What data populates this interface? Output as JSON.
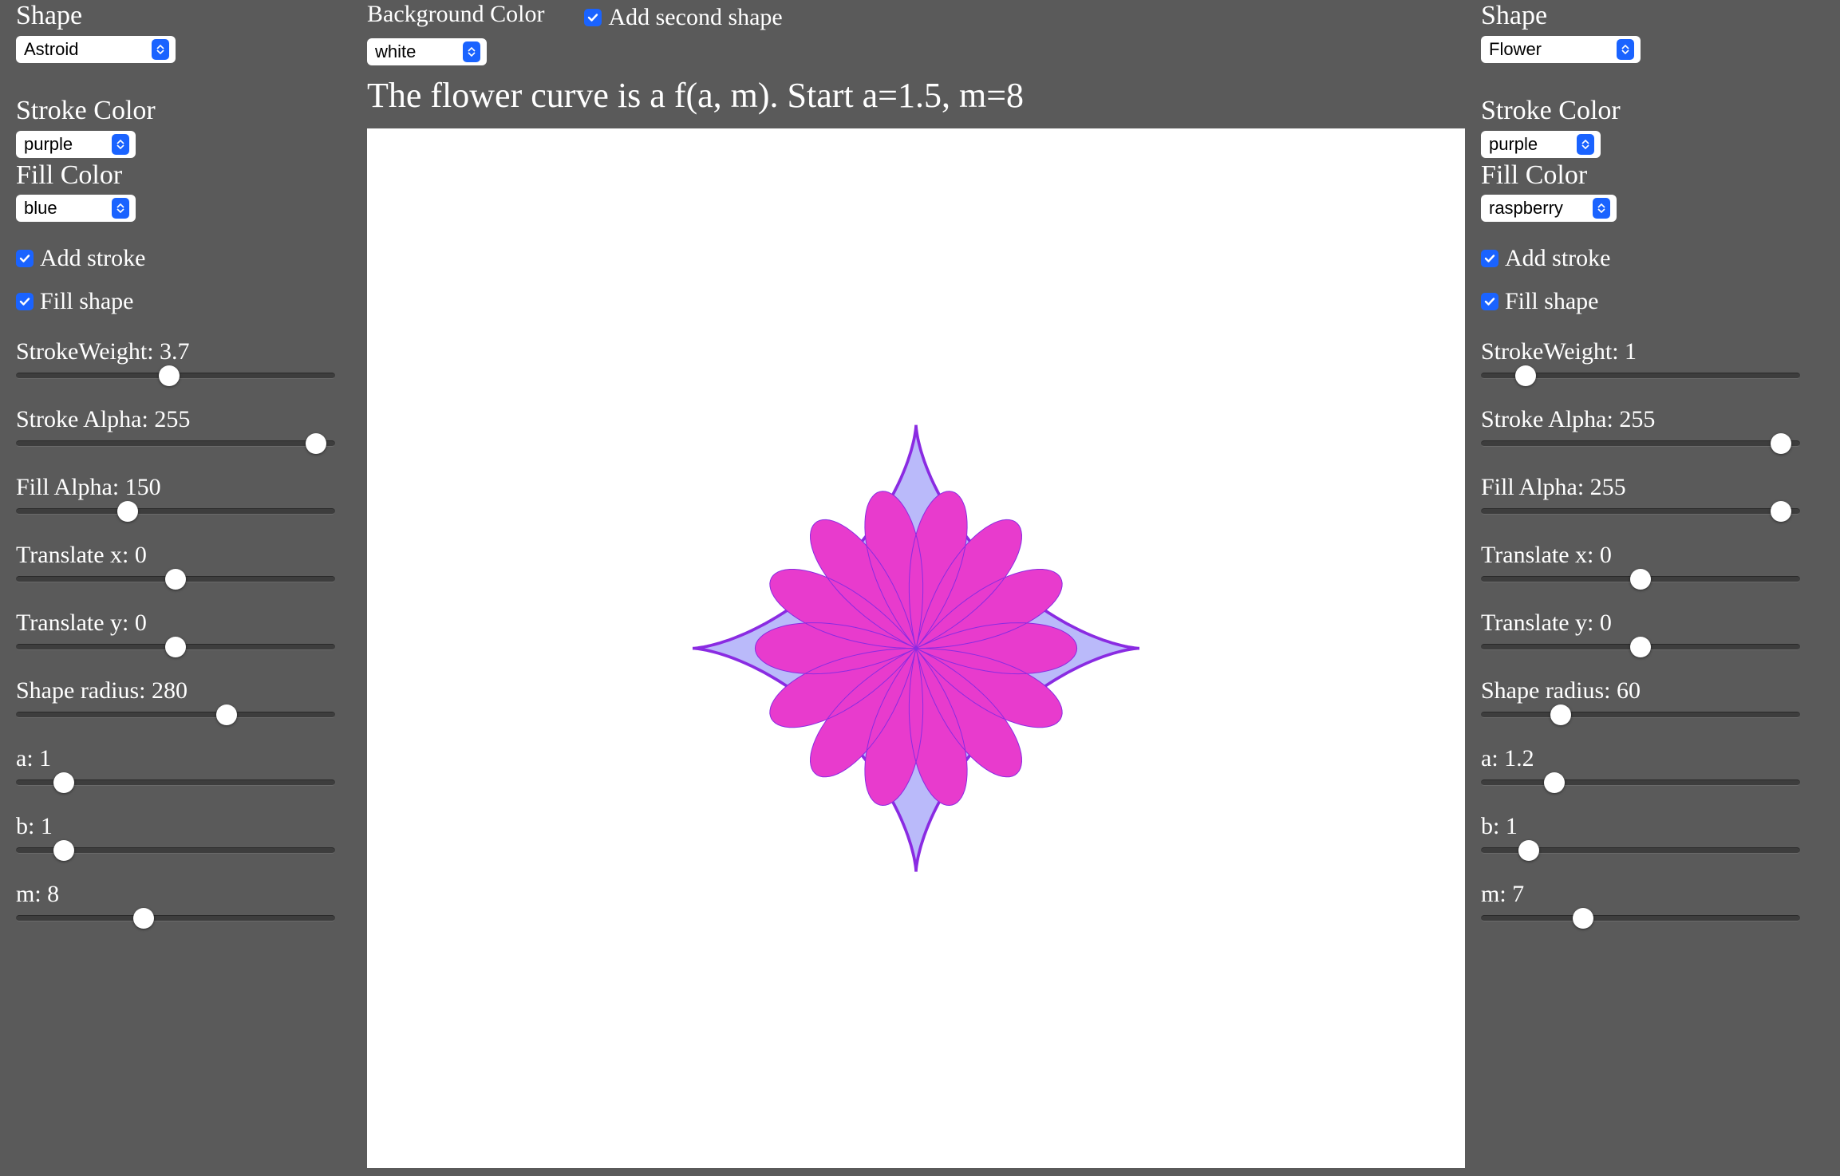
{
  "left": {
    "shape_label": "Shape",
    "shape_value": "Astroid",
    "stroke_color_label": "Stroke Color",
    "stroke_color_value": "purple",
    "fill_color_label": "Fill Color",
    "fill_color_value": "blue",
    "add_stroke_label": "Add stroke",
    "add_stroke_checked": true,
    "fill_shape_label": "Fill shape",
    "fill_shape_checked": true,
    "sliders": {
      "stroke_weight": {
        "label": "StrokeWeight: 3.7",
        "pos": 48
      },
      "stroke_alpha": {
        "label": "Stroke Alpha: 255",
        "pos": 94
      },
      "fill_alpha": {
        "label": "Fill Alpha: 150",
        "pos": 35
      },
      "tx": {
        "label": "Translate x: 0",
        "pos": 50
      },
      "ty": {
        "label": "Translate y: 0",
        "pos": 50
      },
      "radius": {
        "label": "Shape radius: 280",
        "pos": 66
      },
      "a": {
        "label": "a: 1",
        "pos": 15
      },
      "b": {
        "label": "b: 1",
        "pos": 15
      },
      "m": {
        "label": "m: 8",
        "pos": 40
      }
    }
  },
  "center": {
    "bg_label": "Background Color",
    "bg_value": "white",
    "add_second_label": "Add second shape",
    "add_second_checked": true,
    "subtitle": "The flower curve is a f(a, m). Start a=1.5, m=8",
    "canvas": {
      "astroid": {
        "stroke": "#8a2be2",
        "fill": "#8a8af7",
        "fill_opacity": 0.59,
        "stroke_width": 3.7,
        "radius": 280
      },
      "flower": {
        "stroke": "#8a2be2",
        "fill": "#e83bcd",
        "stroke_width": 1,
        "radius": 60,
        "a": 1.2,
        "m": 7
      }
    }
  },
  "right": {
    "shape_label": "Shape",
    "shape_value": "Flower",
    "stroke_color_label": "Stroke Color",
    "stroke_color_value": "purple",
    "fill_color_label": "Fill Color",
    "fill_color_value": "raspberry",
    "add_stroke_label": "Add stroke",
    "add_stroke_checked": true,
    "fill_shape_label": "Fill shape",
    "fill_shape_checked": true,
    "sliders": {
      "stroke_weight": {
        "label": "StrokeWeight: 1",
        "pos": 14
      },
      "stroke_alpha": {
        "label": "Stroke Alpha: 255",
        "pos": 94
      },
      "fill_alpha": {
        "label": "Fill Alpha: 255",
        "pos": 94
      },
      "tx": {
        "label": "Translate x: 0",
        "pos": 50
      },
      "ty": {
        "label": "Translate y: 0",
        "pos": 50
      },
      "radius": {
        "label": "Shape radius: 60",
        "pos": 25
      },
      "a": {
        "label": "a: 1.2",
        "pos": 23
      },
      "b": {
        "label": "b: 1",
        "pos": 15
      },
      "m": {
        "label": "m: 7",
        "pos": 32
      }
    }
  }
}
